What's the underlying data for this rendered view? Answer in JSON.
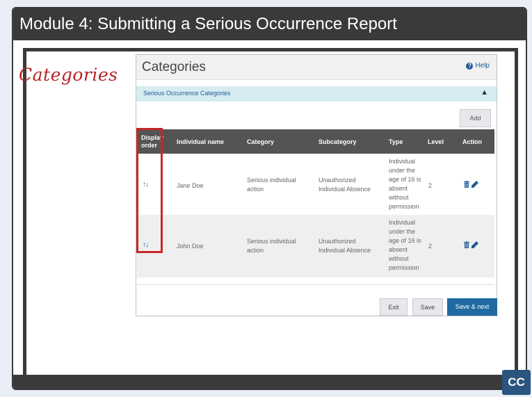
{
  "module_title": "Module 4:  Submitting a Serious Occurrence Report",
  "slide_label": "Categories",
  "app": {
    "title": "Categories",
    "help_label": "Help",
    "help_icon": "question-circle-icon",
    "section_title": "Serious Occurrence Categories",
    "section_chevron": "^",
    "add_label": "Add",
    "table": {
      "headers": [
        "Display order",
        "Individual name",
        "Category",
        "Subcategory",
        "Type",
        "Level",
        "Action"
      ],
      "rows": [
        {
          "order_icon": "up-down-arrows-icon",
          "order_glyph": "↑↓",
          "name": "Jane Doe",
          "category": "Serious individual action",
          "subcategory": "Unauthorized Individual Absence",
          "type": "Individual under the age of 16 is absent without permission",
          "level": "2"
        },
        {
          "order_icon": "up-down-arrows-icon",
          "order_glyph": "↑↓",
          "name": "John Doe",
          "category": "Serious individual action",
          "subcategory": "Unauthorized Individual Absence",
          "type": "Individual under the age of 16 is absent without permission",
          "level": "2"
        }
      ]
    },
    "footer": {
      "exit_label": "Exit",
      "save_label": "Save",
      "save_next_label": "Save & next"
    }
  },
  "cc_label": "CC",
  "colors": {
    "title_bar": "#3a3a3a",
    "accent_red": "#c62828",
    "link_blue": "#1f5a99",
    "primary_button": "#1f6aa0",
    "table_header": "#545454"
  }
}
